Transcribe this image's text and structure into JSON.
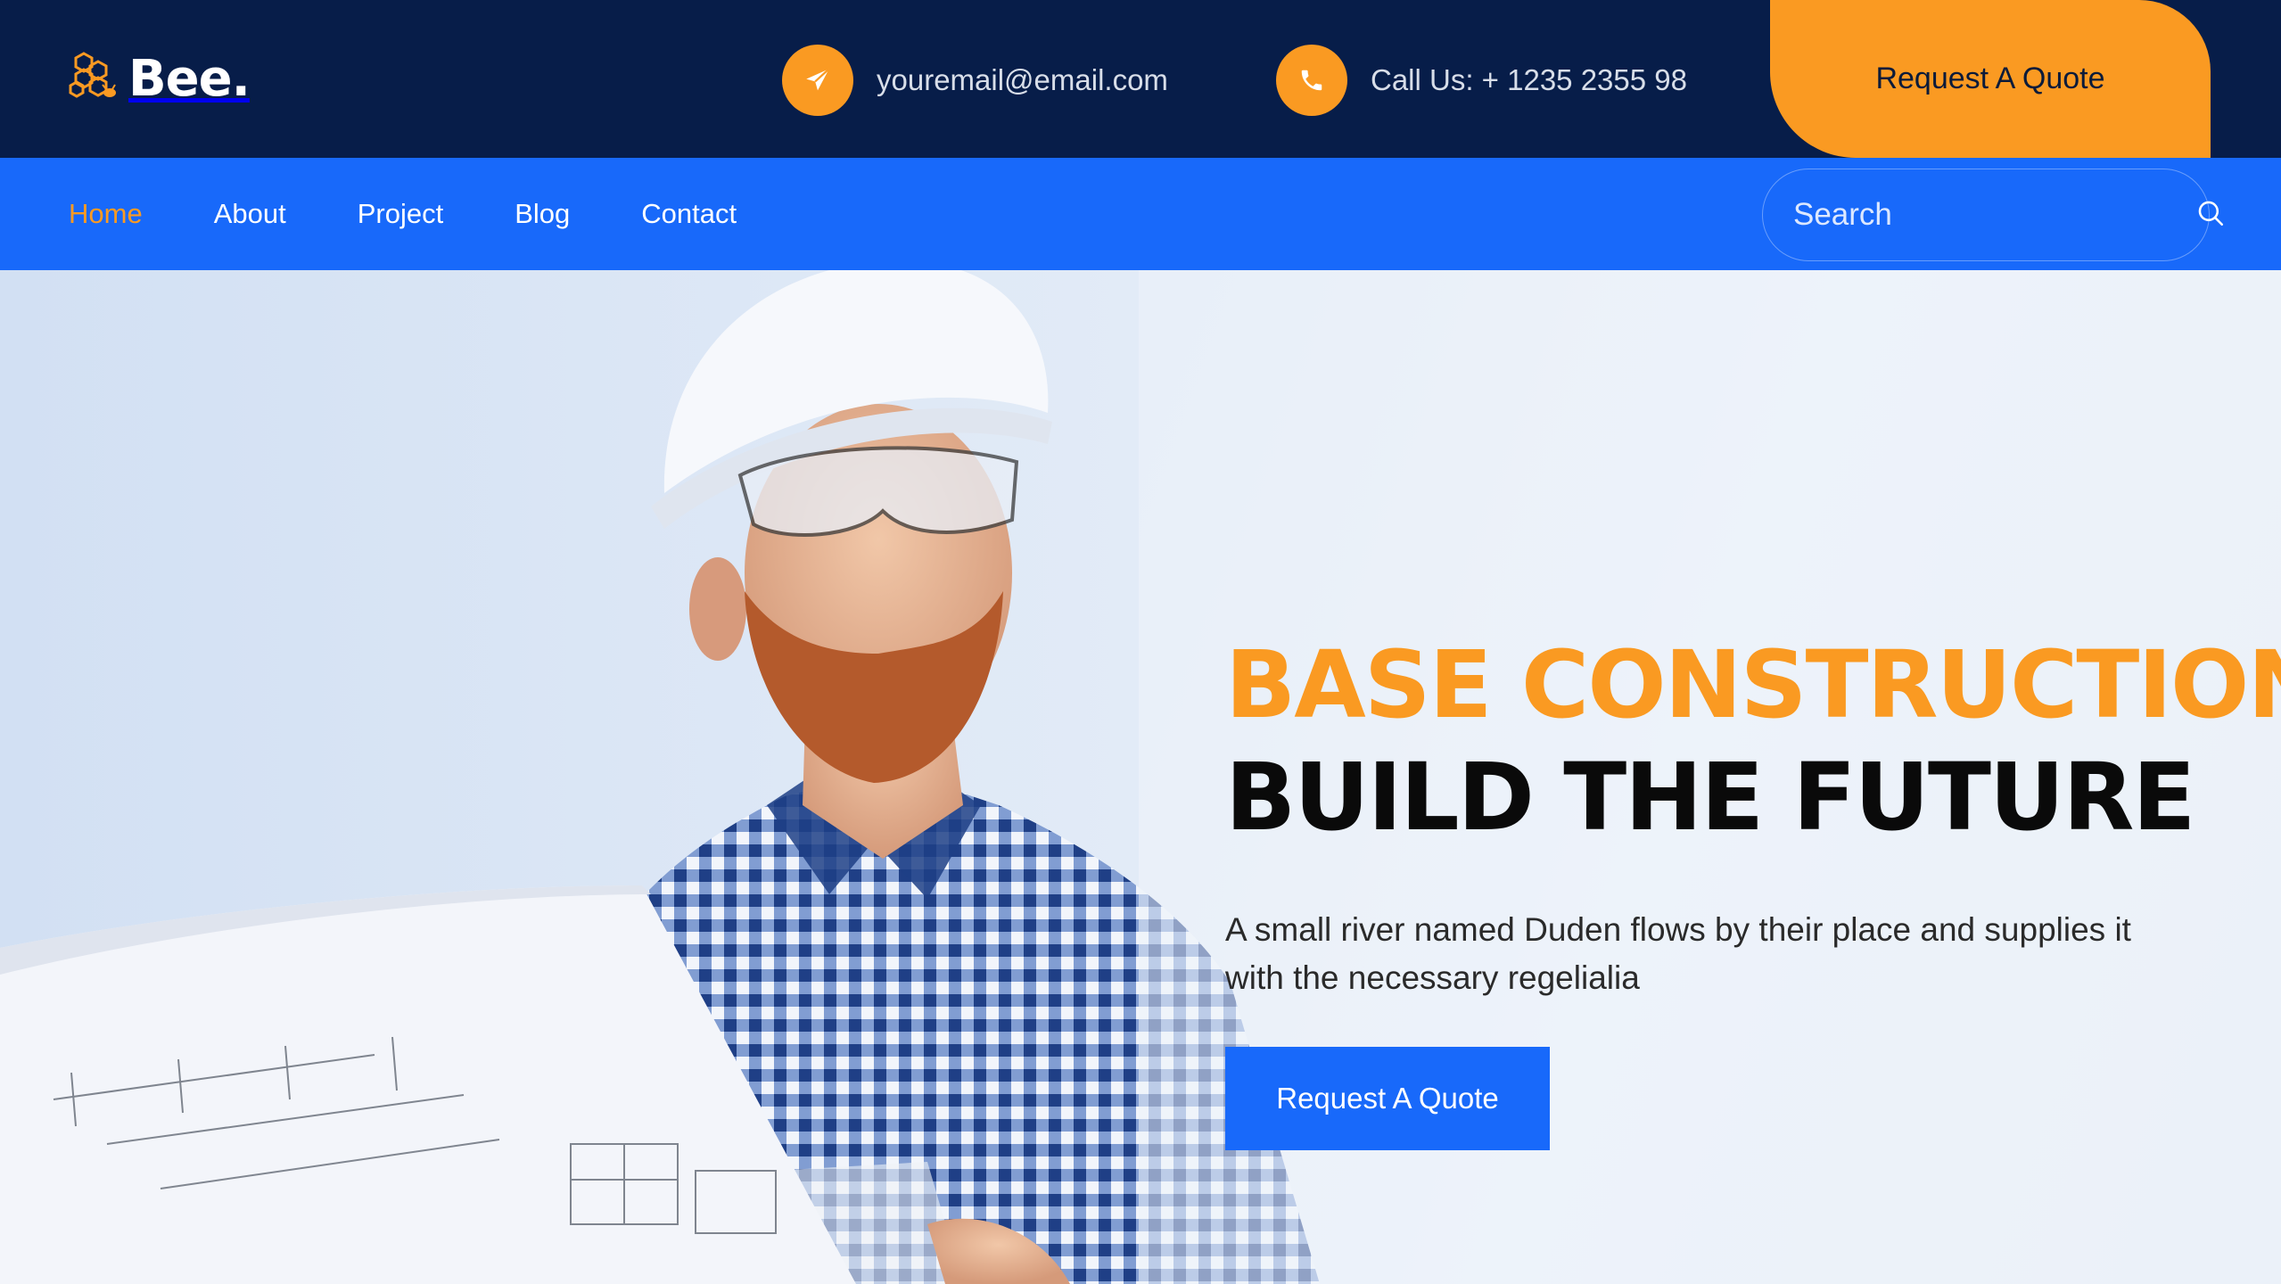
{
  "brand": {
    "logo_text": "Bee.",
    "colors": {
      "navy": "#071d49",
      "orange": "#fa9a22",
      "blue": "#1869fa"
    }
  },
  "topbar": {
    "email": {
      "icon": "paper-plane-icon",
      "text": "youremail@email.com"
    },
    "phone": {
      "icon": "phone-icon",
      "text": "Call Us: + 1235 2355 98"
    },
    "quote_button": "Request A Quote"
  },
  "nav": {
    "items": [
      {
        "label": "Home",
        "active": true
      },
      {
        "label": "About",
        "active": false
      },
      {
        "label": "Project",
        "active": false
      },
      {
        "label": "Blog",
        "active": false
      },
      {
        "label": "Contact",
        "active": false
      }
    ],
    "search": {
      "placeholder": "Search",
      "icon": "search-icon"
    }
  },
  "hero": {
    "headline_line1": "BASE CONSTRUCTION",
    "headline_line2": "BUILD THE FUTURE",
    "description": "A small river named Duden flows by their place and supplies it with the necessary regelialia",
    "cta_button": "Request A Quote"
  }
}
